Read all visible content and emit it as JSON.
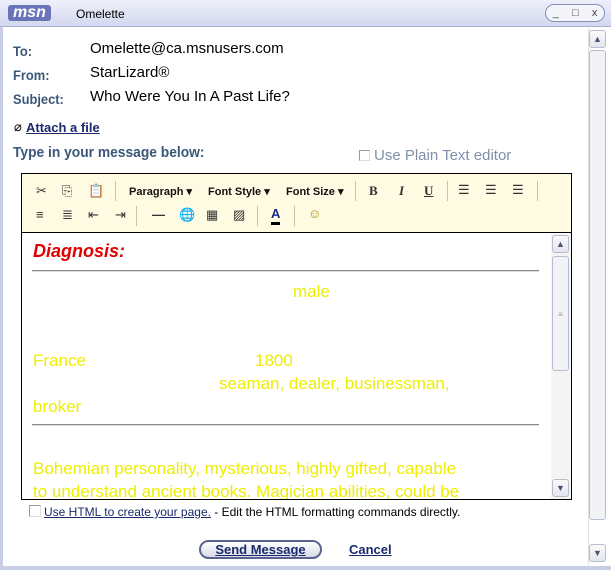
{
  "window": {
    "logo": "msn",
    "title": "Omelette",
    "buttons": [
      "_",
      "□",
      "x"
    ]
  },
  "header": {
    "to_label": "To:",
    "to": "Omelette@ca.msnusers.com",
    "from_label": "From:",
    "from": "StarLizard®",
    "subject_label": "Subject:",
    "subject": "Who Were You In A Past Life?",
    "attach": "Attach a file",
    "prompt": "Type in your message below:",
    "plain_text": "Use Plain Text editor"
  },
  "toolbar": {
    "paragraph": "Paragraph ▾",
    "font_style": "Font Style ▾",
    "font_size": "Font Size ▾",
    "bold": "B",
    "italic": "I",
    "underline": "U"
  },
  "message": {
    "heading": "Diagnosis:",
    "gender": "male",
    "country": "France",
    "year": "1800",
    "professions": "seaman, dealer, businessman,",
    "professions2": "broker",
    "desc1": "Bohemian personality, mysterious, highly gifted, capable",
    "desc2": "to understand ancient books. Magician abilities, could be"
  },
  "footer": {
    "html_link": "Use HTML to create your page.",
    "html_desc": " - Edit the HTML formatting commands directly.",
    "send": "Send Message",
    "cancel": "Cancel"
  },
  "colors": {
    "heading": "#e00000",
    "body_text": "#eeee00",
    "label": "#3b5878"
  }
}
